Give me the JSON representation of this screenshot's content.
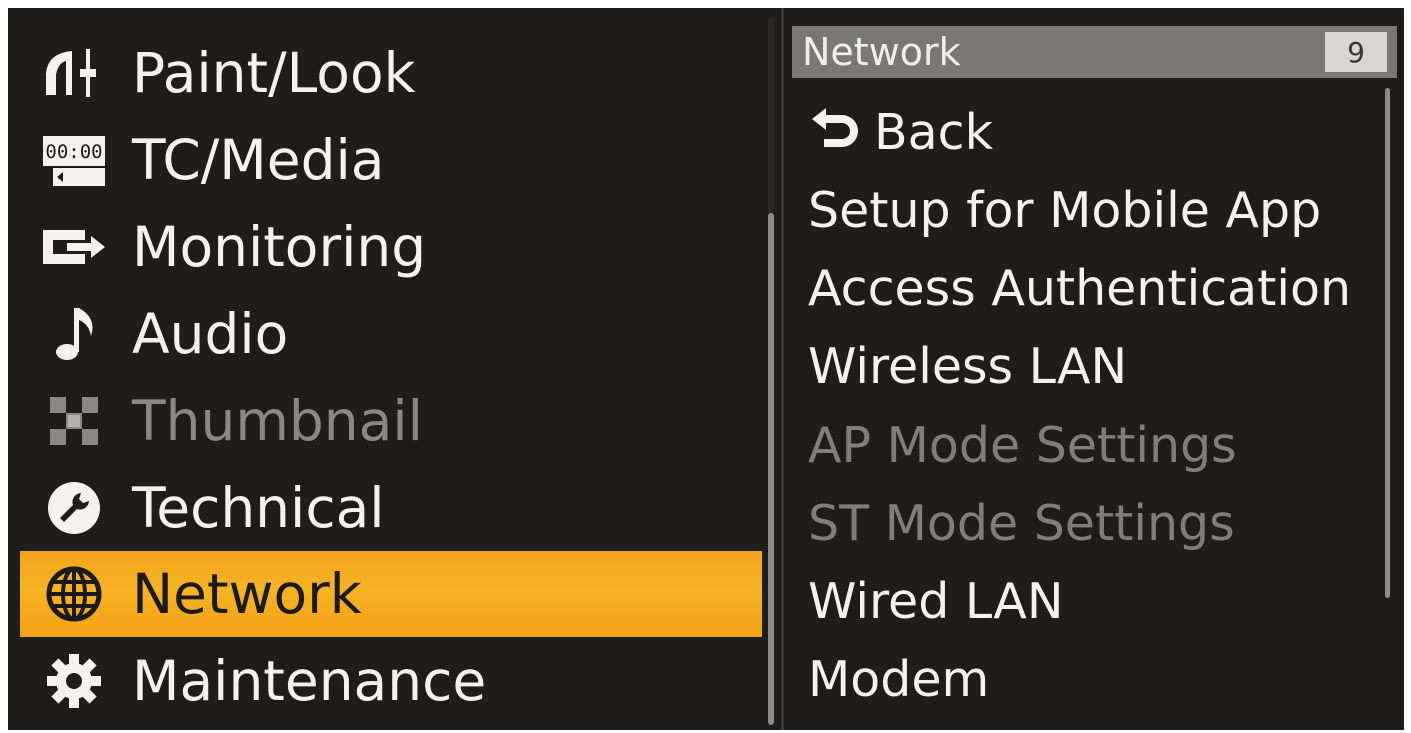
{
  "menu": {
    "items": [
      {
        "label": "Paint/Look",
        "icon": "paint-look-icon",
        "state": "normal"
      },
      {
        "label": "TC/Media",
        "icon": "tc-media-icon",
        "state": "normal"
      },
      {
        "label": "Monitoring",
        "icon": "monitoring-icon",
        "state": "normal"
      },
      {
        "label": "Audio",
        "icon": "music-note-icon",
        "state": "normal"
      },
      {
        "label": "Thumbnail",
        "icon": "thumbnail-icon",
        "state": "disabled"
      },
      {
        "label": "Technical",
        "icon": "wrench-icon",
        "state": "normal"
      },
      {
        "label": "Network",
        "icon": "globe-icon",
        "state": "selected"
      },
      {
        "label": "Maintenance",
        "icon": "gear-icon",
        "state": "normal"
      }
    ],
    "tc_icon_text": "00:00"
  },
  "submenu": {
    "title": "Network",
    "page": "9",
    "items": [
      {
        "label": "Back",
        "icon": "back-arrow-icon",
        "state": "normal"
      },
      {
        "label": "Setup for Mobile App",
        "state": "normal"
      },
      {
        "label": "Access Authentication",
        "state": "normal"
      },
      {
        "label": "Wireless LAN",
        "state": "normal"
      },
      {
        "label": "AP Mode Settings",
        "state": "disabled"
      },
      {
        "label": "ST Mode Settings",
        "state": "disabled"
      },
      {
        "label": "Wired LAN",
        "state": "normal"
      },
      {
        "label": "Modem",
        "state": "normal"
      }
    ]
  },
  "colors": {
    "background": "#1f1d1a",
    "selected": "#f7b323",
    "header": "#7a7874",
    "text": "#f4f2ee",
    "disabled_text": "#8a8884"
  }
}
